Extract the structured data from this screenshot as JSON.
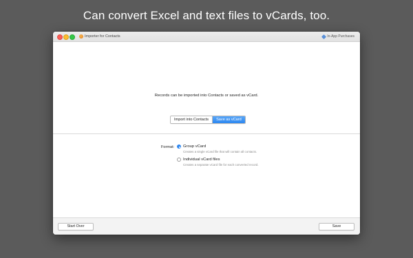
{
  "headline": "Can convert Excel and text files to vCards, too.",
  "window": {
    "title": "Importer for Contacts",
    "in_app_purchases": "In-App Purchases"
  },
  "top": {
    "message": "Records can be imported into Contacts or saved as vCard.",
    "segments": [
      {
        "label": "Import into Contacts",
        "selected": false
      },
      {
        "label": "Save as vCard",
        "selected": true
      }
    ]
  },
  "options": {
    "format_label": "Format:",
    "choices": [
      {
        "label": "Group vCard",
        "description": "Creates a single vCard file that will contain all contacts.",
        "checked": true
      },
      {
        "label": "Individual vCard files",
        "description": "Creates a separate vCard file for each converted record.",
        "checked": false
      }
    ]
  },
  "footer": {
    "start_over_label": "Start Over",
    "save_label": "Save"
  },
  "colors": {
    "background": "#5b5b5b",
    "accent": "#2c86f0"
  }
}
